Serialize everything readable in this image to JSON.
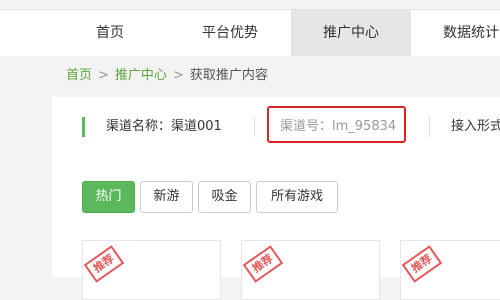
{
  "nav": {
    "items": [
      {
        "label": "首页",
        "active": false
      },
      {
        "label": "平台优势",
        "active": false
      },
      {
        "label": "推广中心",
        "active": true
      },
      {
        "label": "数据统计",
        "active": false
      }
    ]
  },
  "breadcrumb": {
    "home": "首页",
    "separator": ">",
    "section": "推广中心",
    "current": "获取推广内容"
  },
  "channel": {
    "name_text": "渠道名称：渠道001",
    "id_text": "渠道号：lm_95834",
    "access_form_text": "接入形式"
  },
  "categories": [
    {
      "label": "热门",
      "active": true
    },
    {
      "label": "新游",
      "active": false
    },
    {
      "label": "吸金",
      "active": false
    },
    {
      "label": "所有游戏",
      "active": false
    }
  ],
  "cards": [
    {
      "stamp": "推荐"
    },
    {
      "stamp": "推荐"
    },
    {
      "stamp": "推荐"
    }
  ],
  "colors": {
    "accent_green": "#5cb85c",
    "highlight_red": "#d62626",
    "breadcrumb_link": "#5aa53e"
  }
}
